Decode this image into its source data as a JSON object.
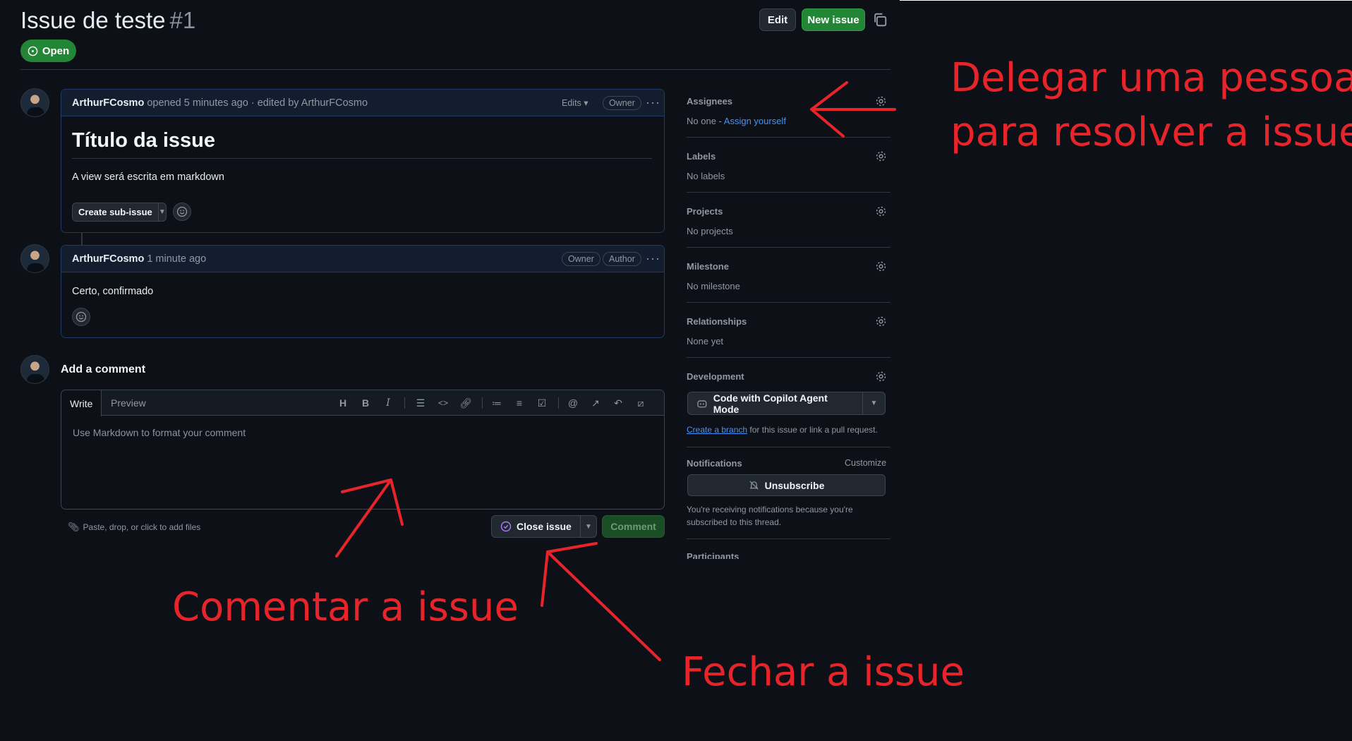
{
  "header": {
    "title": "Issue de teste",
    "number": "#1",
    "edit_label": "Edit",
    "new_issue_label": "New issue",
    "status": "Open"
  },
  "comment1": {
    "author": "ArthurFCosmo",
    "meta": "opened 5 minutes ago · edited by ArthurFCosmo",
    "edits_label": "Edits",
    "badge": "Owner",
    "heading": "Título da issue",
    "body": "A view será escrita em markdown",
    "sub_issue_label": "Create sub-issue"
  },
  "comment2": {
    "author": "ArthurFCosmo",
    "meta": "1 minute ago",
    "badge_owner": "Owner",
    "badge_author": "Author",
    "body": "Certo, confirmado"
  },
  "add_comment": {
    "heading": "Add a comment",
    "tab_write": "Write",
    "tab_preview": "Preview",
    "placeholder": "Use Markdown to format your comment",
    "attach_hint": "Paste, drop, or click to add files",
    "close_label": "Close issue",
    "comment_label": "Comment"
  },
  "sidebar": {
    "assignees": {
      "title": "Assignees",
      "value": "No one -",
      "action": "Assign yourself"
    },
    "labels": {
      "title": "Labels",
      "value": "No labels"
    },
    "projects": {
      "title": "Projects",
      "value": "No projects"
    },
    "milestone": {
      "title": "Milestone",
      "value": "No milestone"
    },
    "relationships": {
      "title": "Relationships",
      "value": "None yet"
    },
    "development": {
      "title": "Development",
      "copilot_label": "Code with Copilot Agent Mode",
      "branch_link": "Create a branch",
      "branch_text": "for this issue or link a pull request."
    },
    "notifications": {
      "title": "Notifications",
      "customize": "Customize",
      "unsubscribe": "Unsubscribe",
      "note_line1": "You're receiving notifications because you're",
      "note_line2": "subscribed to this thread."
    },
    "participants": {
      "title": "Participants"
    }
  },
  "annotations": {
    "assign_line1": "Delegar uma pessoa",
    "assign_line2": "para resolver a issue",
    "comment": "Comentar a issue",
    "close": "Fechar a issue"
  },
  "colors": {
    "annotation": "#e8242b",
    "green": "#238636",
    "link": "#4493f8"
  }
}
